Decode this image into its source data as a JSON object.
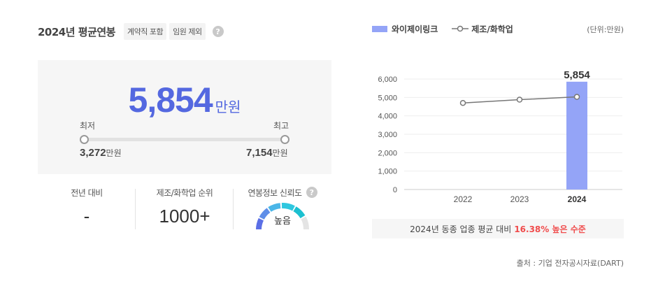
{
  "summary": {
    "title": "2024년 평균연봉",
    "chips": [
      "계약직 포함",
      "임원 제외"
    ],
    "help_icon": "question-icon",
    "salary": "5,854",
    "salary_unit": "만원",
    "min_label": "최저",
    "max_label": "최고",
    "min_value": "3,272",
    "max_value": "7,154",
    "value_unit": "만원"
  },
  "stats": {
    "yoy_label": "전년 대비",
    "yoy_value": "-",
    "rank_label": "제조/화학업 순위",
    "rank_value": "1000+",
    "reliability_label": "연봉정보 신뢰도",
    "reliability_value": "높음",
    "reliability_level": 0.72
  },
  "legend": {
    "company": "와이제이링크",
    "industry": "제조/화학업",
    "unit_note": "(단위:만원)"
  },
  "colors": {
    "accent": "#5468e0",
    "bar": "#94a4f7",
    "line": "#777777",
    "highlight": "#f04c4c"
  },
  "chart_data": {
    "type": "bar",
    "categories": [
      "2022",
      "2023",
      "2024"
    ],
    "series": [
      {
        "name": "와이제이링크",
        "type": "bar",
        "values": [
          null,
          null,
          5854
        ]
      },
      {
        "name": "제조/화학업",
        "type": "line",
        "values": [
          4700,
          4880,
          5030
        ]
      }
    ],
    "bar_label": "5,854",
    "y_ticks": [
      "0",
      "1,000",
      "2,000",
      "3,000",
      "4,000",
      "5,000",
      "6,000"
    ],
    "ylim": [
      0,
      6000
    ],
    "grid": true
  },
  "comparison": {
    "prefix": "2024년 동종 업종 평균 대비",
    "highlight": "16.38% 높은 수준"
  },
  "source": "출처 : 기업 전자공시자료(DART)"
}
